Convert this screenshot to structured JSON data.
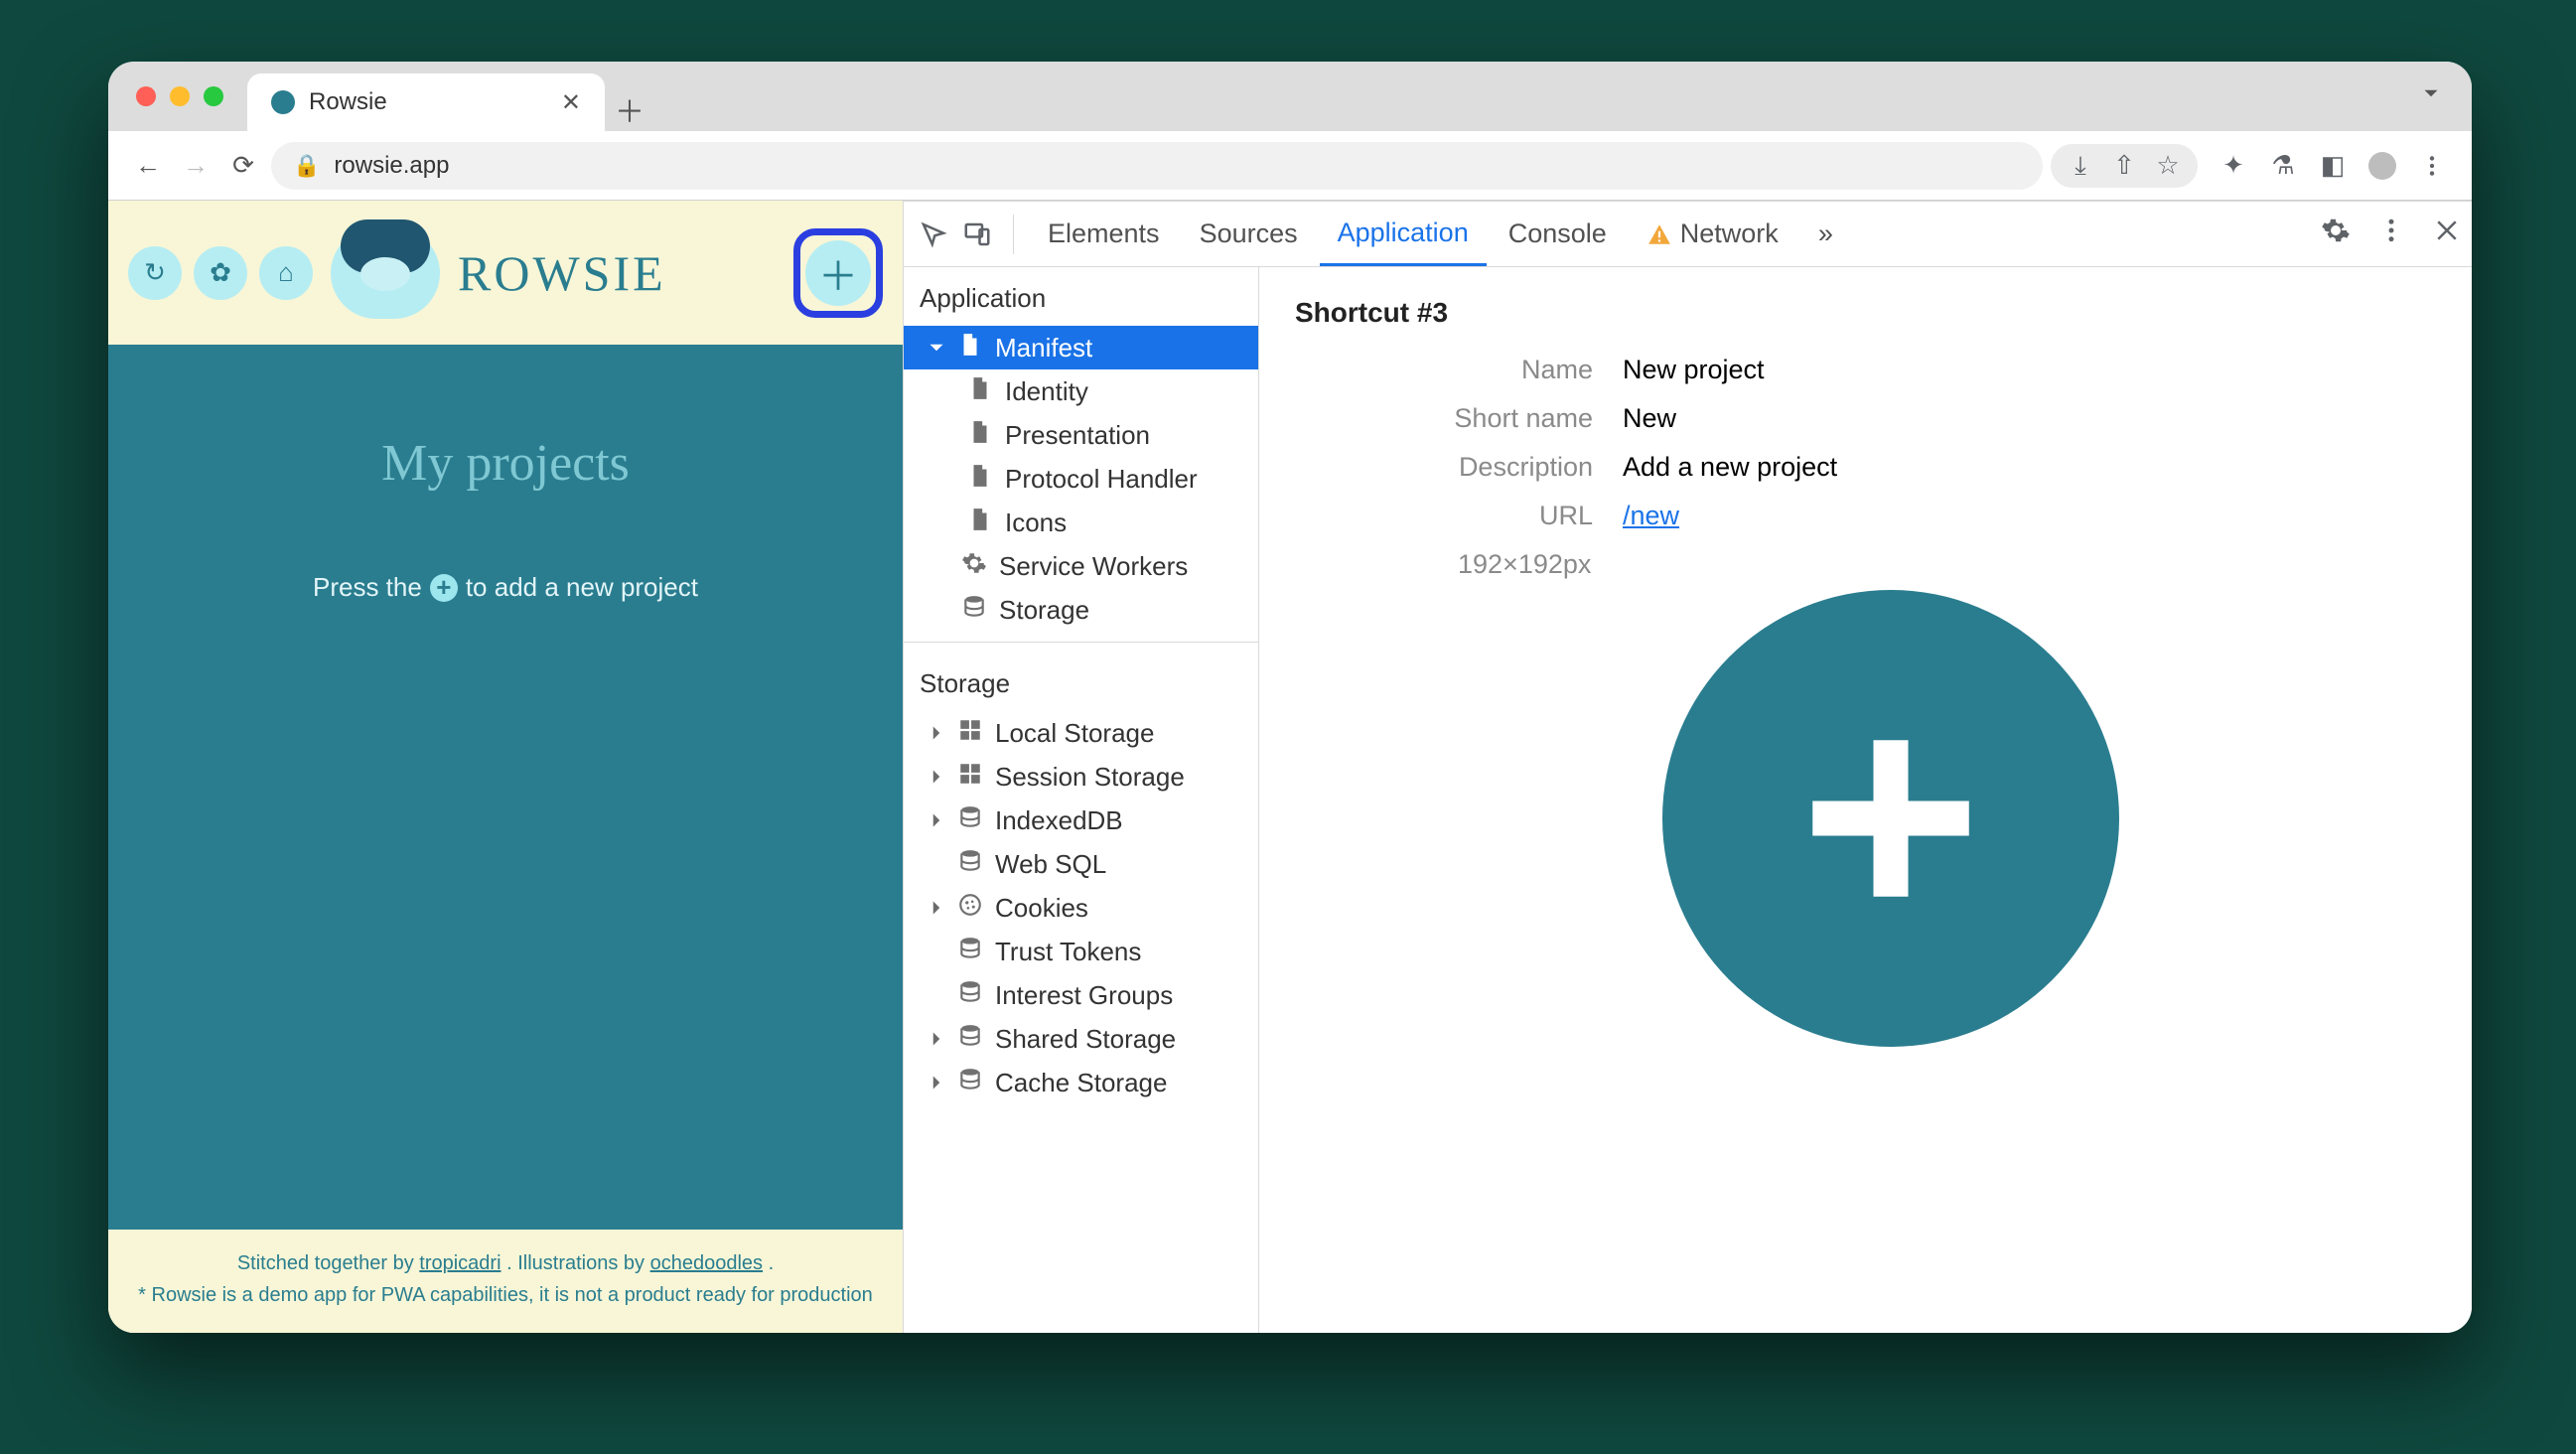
{
  "browser": {
    "tab_title": "Rowsie",
    "url_display": "rowsie.app"
  },
  "site": {
    "logo_text": "ROWSIE",
    "page_title": "My projects",
    "hint_prefix": "Press the",
    "hint_suffix": "to add a new project",
    "footer_line1_a": "Stitched together by ",
    "footer_link1": "tropicadri",
    "footer_line1_b": ". Illustrations by ",
    "footer_link2": "ochedoodles",
    "footer_line1_c": ".",
    "footer_line2": "* Rowsie is a demo app for PWA capabilities, it is not a product ready for production"
  },
  "devtools": {
    "tabs": {
      "elements": "Elements",
      "sources": "Sources",
      "application": "Application",
      "console": "Console",
      "network": "Network",
      "more": "»"
    },
    "tree": {
      "application_heading": "Application",
      "manifest": "Manifest",
      "identity": "Identity",
      "presentation": "Presentation",
      "protocol_handler": "Protocol Handler",
      "icons": "Icons",
      "service_workers": "Service Workers",
      "storage": "Storage",
      "storage_heading": "Storage",
      "local_storage": "Local Storage",
      "session_storage": "Session Storage",
      "indexeddb": "IndexedDB",
      "web_sql": "Web SQL",
      "cookies": "Cookies",
      "trust_tokens": "Trust Tokens",
      "interest_groups": "Interest Groups",
      "shared_storage": "Shared Storage",
      "cache_storage": "Cache Storage"
    },
    "detail": {
      "title": "Shortcut #3",
      "labels": {
        "name": "Name",
        "short_name": "Short name",
        "description": "Description",
        "url": "URL"
      },
      "values": {
        "name": "New project",
        "short_name": "New",
        "description": "Add a new project",
        "url": "/new"
      },
      "dimensions": "192×192px"
    }
  }
}
